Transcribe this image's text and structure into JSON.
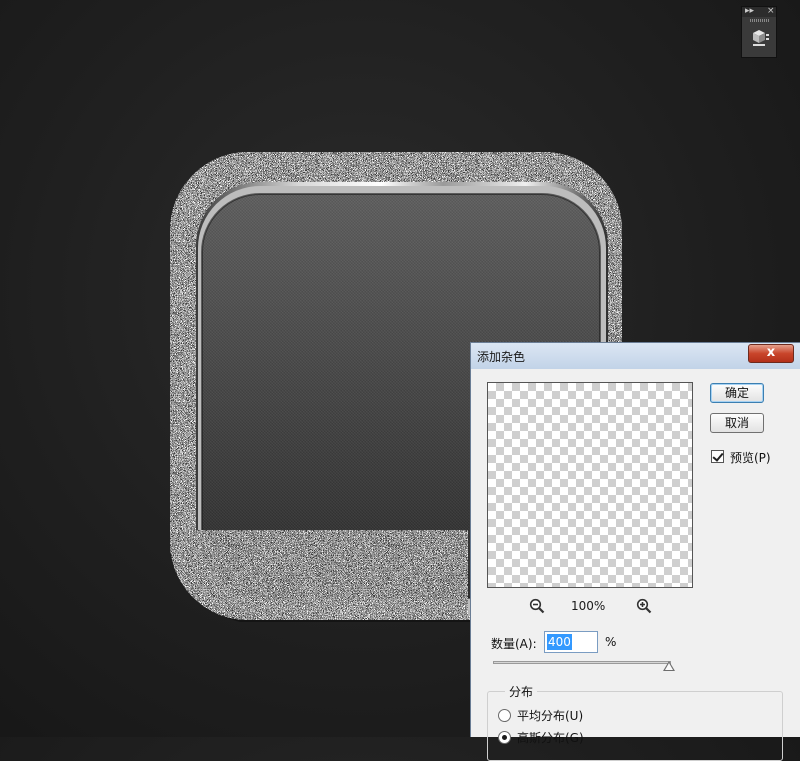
{
  "dialog": {
    "title": "添加杂色",
    "close_glyph": "x",
    "ok_label": "确定",
    "cancel_label": "取消",
    "preview_label": "预览(P)",
    "preview_checked": true,
    "zoom_level": "100%",
    "amount_label": "数量(A):",
    "amount_value": "400",
    "amount_unit": "%",
    "distribution": {
      "legend": "分布",
      "options": [
        {
          "label": "平均分布(U)",
          "checked": false
        },
        {
          "label": "高斯分布(G)",
          "checked": true
        }
      ]
    }
  },
  "panel": {
    "collapse_glyph": "▸▸",
    "close_glyph": "×"
  },
  "colors": {
    "background": "#1f1f1f",
    "selection": "#3399ff",
    "close_button": "#c9452b"
  }
}
